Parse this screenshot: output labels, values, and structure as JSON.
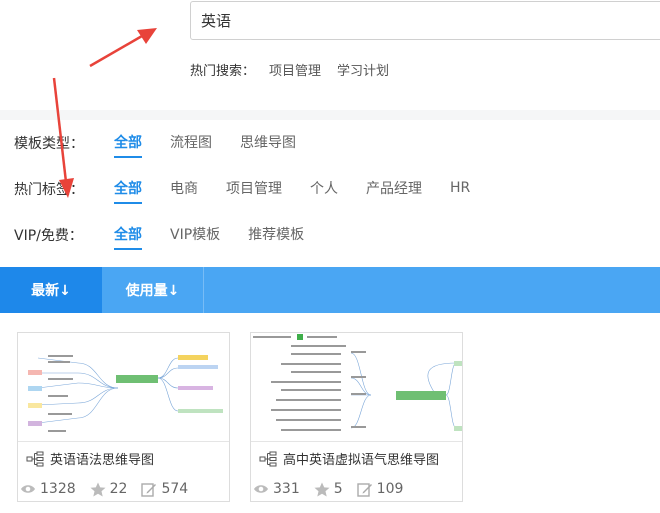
{
  "search": {
    "value": "英语",
    "hot_label": "热门搜索：",
    "hot_links": [
      "项目管理",
      "学习计划"
    ]
  },
  "filters": {
    "type": {
      "label": "模板类型：",
      "options": [
        "全部",
        "流程图",
        "思维导图"
      ],
      "active": 0
    },
    "tags": {
      "label": "热门标签：",
      "options": [
        "全部",
        "电商",
        "项目管理",
        "个人",
        "产品经理",
        "HR"
      ],
      "active": 0
    },
    "vip": {
      "label": "VIP/免费：",
      "options": [
        "全部",
        "VIP模板",
        "推荐模板"
      ],
      "active": 0
    }
  },
  "sort": {
    "newest": "最新↓",
    "usage": "使用量↓"
  },
  "cards": [
    {
      "title": "英语语法思维导图",
      "views": "1328",
      "likes": "22",
      "edits": "574"
    },
    {
      "title": "高中英语虚拟语气思维导图",
      "views": "331",
      "likes": "5",
      "edits": "109"
    }
  ],
  "colors": {
    "accent": "#1f8ce8",
    "sortbar": "#4aa6f3",
    "sort_active": "#1e88ea",
    "arrow": "#e8433a"
  }
}
